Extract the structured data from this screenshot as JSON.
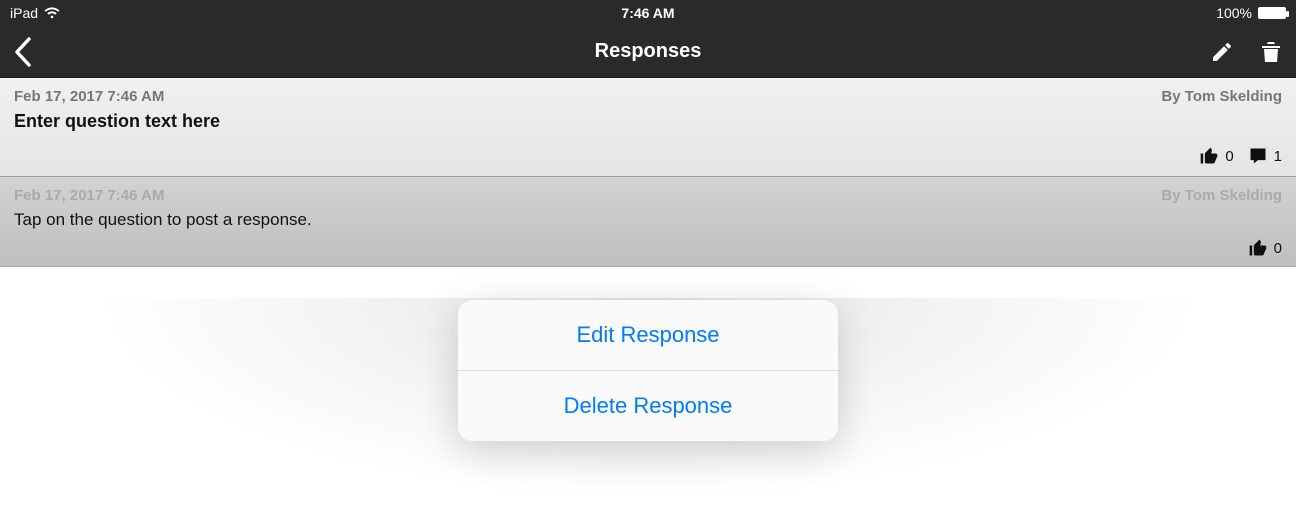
{
  "statusbar": {
    "device": "iPad",
    "time": "7:46 AM",
    "battery_pct": "100%"
  },
  "navbar": {
    "title": "Responses"
  },
  "question": {
    "timestamp": "Feb 17, 2017 7:46 AM",
    "byline": "By Tom Skelding",
    "title": "Enter question text here",
    "likes": "0",
    "comments": "1"
  },
  "response": {
    "timestamp": "Feb 17, 2017 7:46 AM",
    "byline": "By Tom Skelding",
    "body": "Tap on the question to post a response.",
    "likes": "0"
  },
  "popover": {
    "edit": "Edit Response",
    "delete": "Delete Response"
  }
}
